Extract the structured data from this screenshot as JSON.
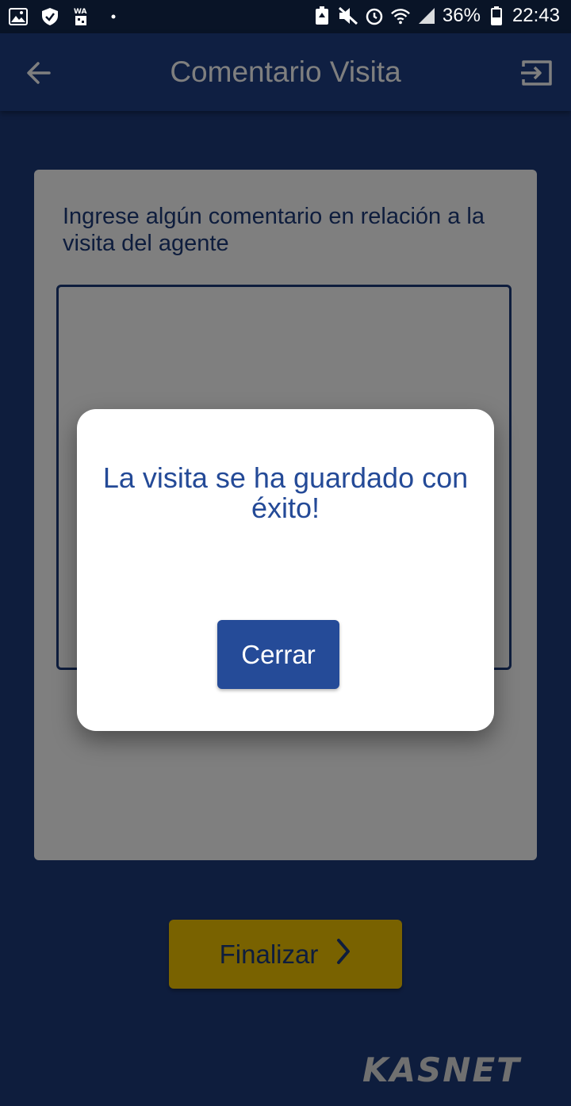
{
  "status_bar": {
    "battery": "36%",
    "time": "22:43",
    "icons": [
      "gallery-icon",
      "shield-icon",
      "whatsapp-icon",
      "dot-icon",
      "battery-saver-icon",
      "mute-icon",
      "alarm-icon",
      "wifi-icon",
      "signal-icon",
      "battery-icon"
    ]
  },
  "app_bar": {
    "title": "Comentario Visita",
    "back_icon": "arrow-back-icon",
    "logout_icon": "logout-icon"
  },
  "form": {
    "prompt": "Ingrese algún comentario en relación a la visita del agente",
    "comment_value": ""
  },
  "actions": {
    "finalize_label": "Finalizar"
  },
  "brand": {
    "logo_text": "KASNET"
  },
  "dialog": {
    "message": "La visita se ha guardado con éxito!",
    "close_label": "Cerrar"
  },
  "colors": {
    "brand_blue": "#1d3a7a",
    "appbar_blue": "#1e3f84",
    "accent_yellow": "#f2c500",
    "button_blue": "#254b98"
  }
}
